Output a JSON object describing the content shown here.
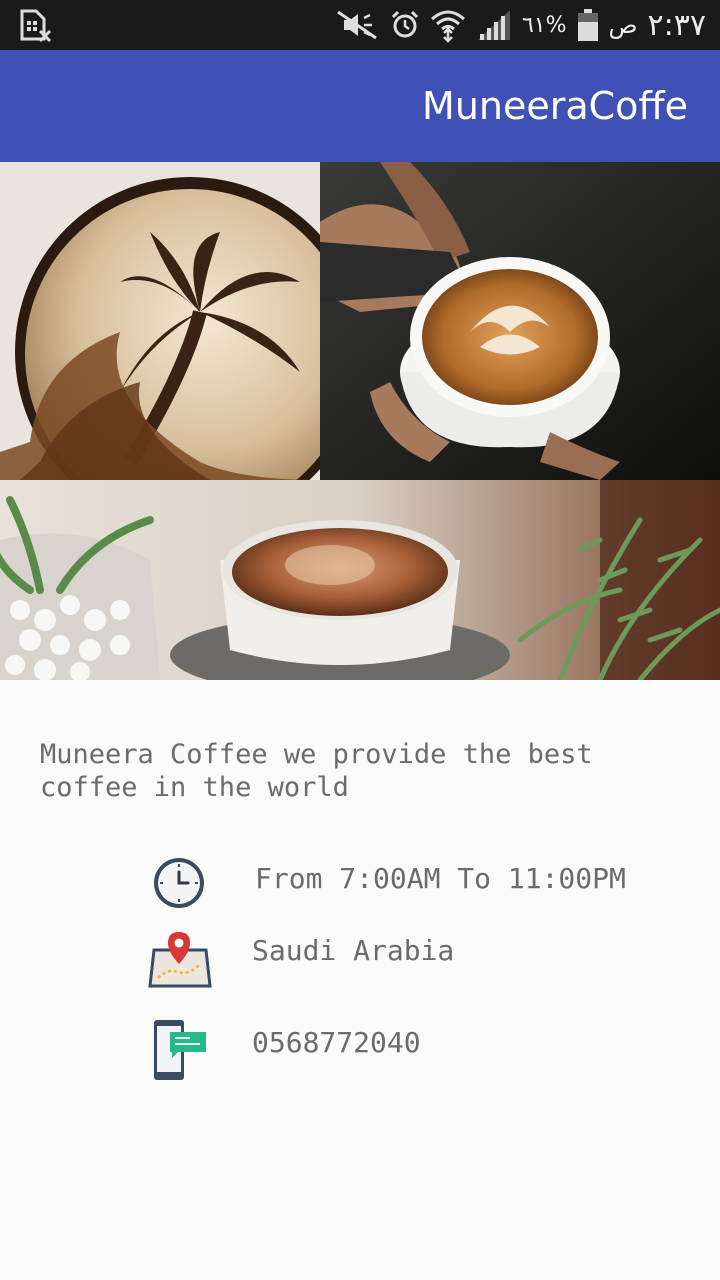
{
  "status_bar": {
    "time": "٢:٣٧",
    "ampm": "ص",
    "battery": "٦١%"
  },
  "app_bar": {
    "title": "MuneeraCoffe"
  },
  "images": [
    {
      "name": "latte-art-palm-tree"
    },
    {
      "name": "barista-pouring-latte"
    },
    {
      "name": "coffee-cup-with-plants"
    }
  ],
  "description": "Muneera Coffee we provide the best coffee in the world",
  "info": {
    "hours": {
      "icon": "clock-icon",
      "text": "From 7:00AM To 11:00PM"
    },
    "location": {
      "icon": "map-pin-icon",
      "text": "Saudi Arabia"
    },
    "phone": {
      "icon": "phone-chat-icon",
      "text": "0568772040"
    }
  },
  "colors": {
    "status_bar": "#1a1a1a",
    "app_bar": "#3f51b5",
    "text": "#6b6b6b",
    "background": "#fafafa"
  }
}
